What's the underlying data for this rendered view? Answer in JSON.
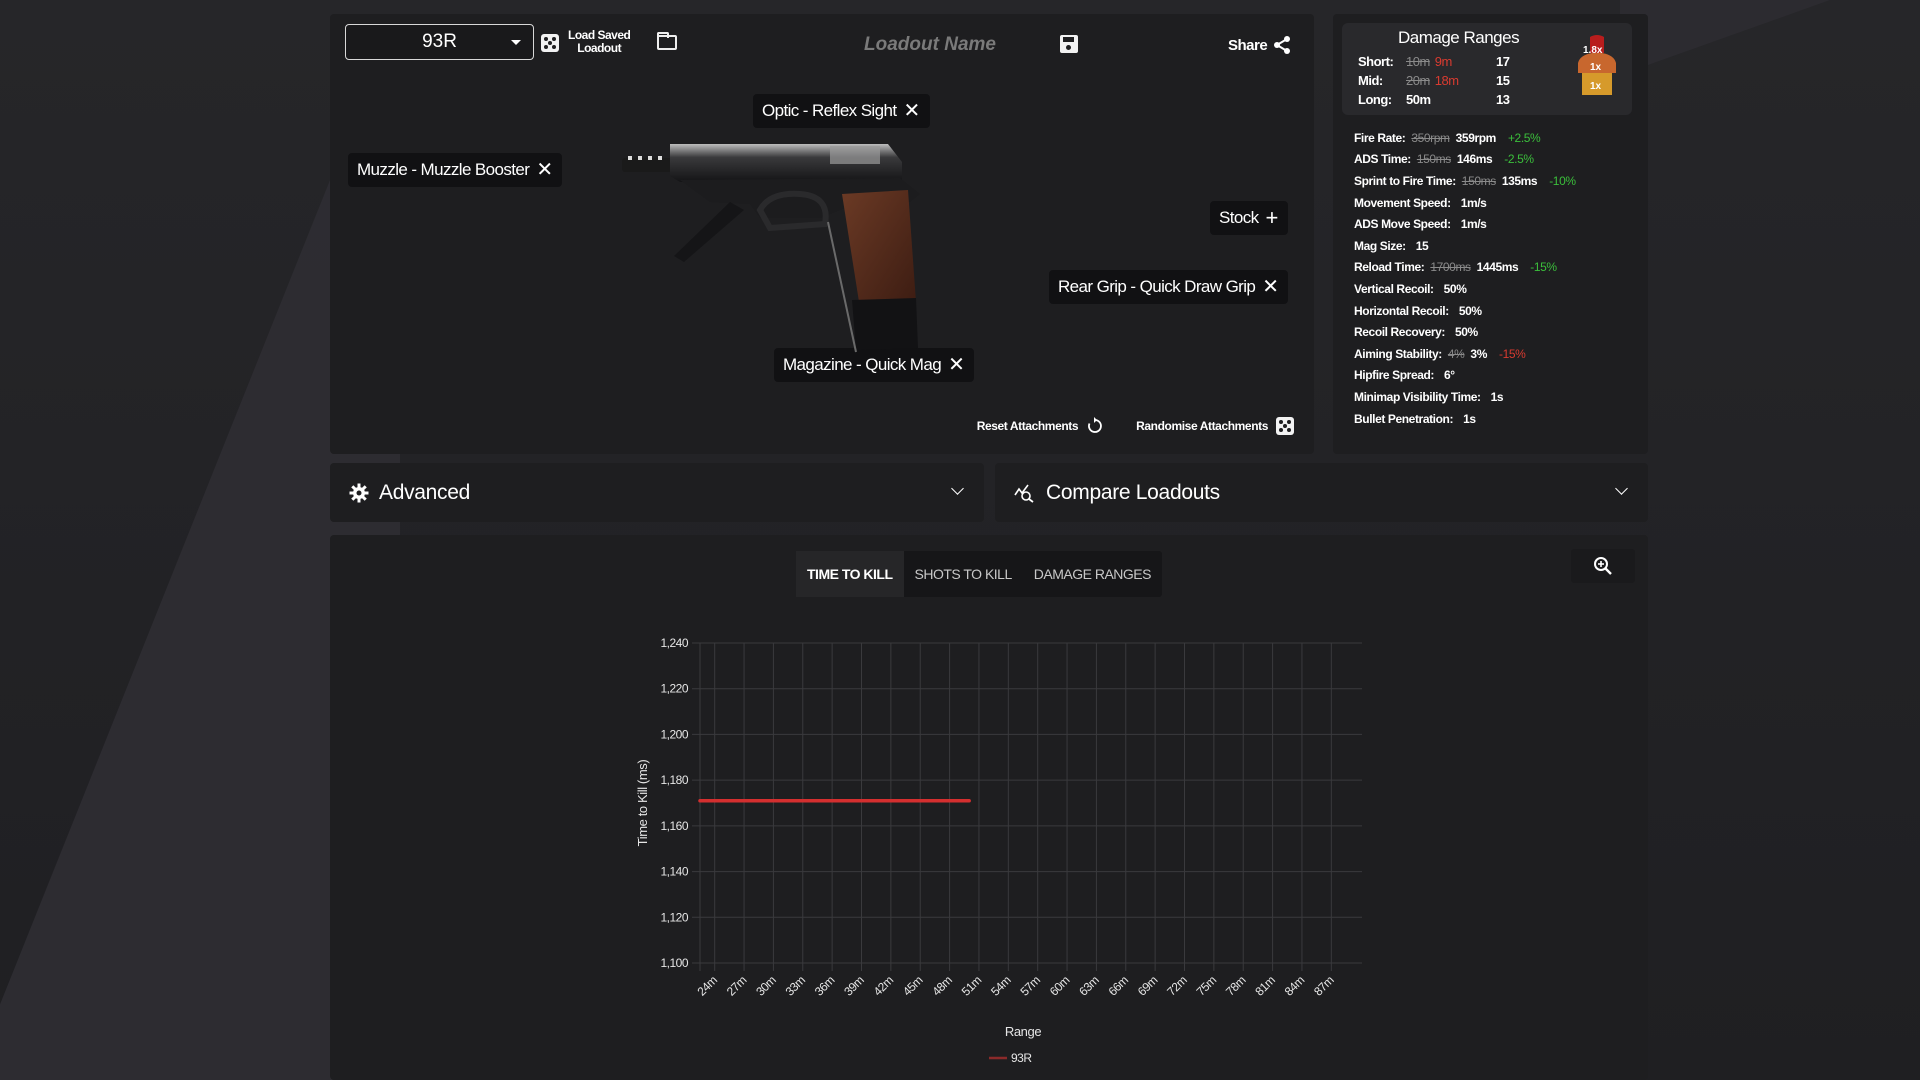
{
  "header": {
    "weapon_selected": "93R",
    "load_saved_line1": "Load Saved",
    "load_saved_line2": "Loadout",
    "loadout_name_placeholder": "Loadout Name",
    "loadout_name_value": "",
    "share_label": "Share"
  },
  "attachments": [
    {
      "slot": "Muzzle",
      "label": "Muzzle - Muzzle Booster",
      "equipped": true
    },
    {
      "slot": "Optic",
      "label": "Optic - Reflex Sight",
      "equipped": true
    },
    {
      "slot": "Stock",
      "label": "Stock",
      "equipped": false
    },
    {
      "slot": "Rear Grip",
      "label": "Rear Grip - Quick Draw Grip",
      "equipped": true
    },
    {
      "slot": "Magazine",
      "label": "Magazine - Quick Mag",
      "equipped": true
    }
  ],
  "attachment_actions": {
    "reset_label": "Reset Attachments",
    "randomise_label": "Randomise Attachments"
  },
  "damage_ranges": {
    "title": "Damage Ranges",
    "rows": [
      {
        "label": "Short:",
        "old_range": "10m",
        "new_range": "9m",
        "damage": "17"
      },
      {
        "label": "Mid:",
        "old_range": "20m",
        "new_range": "18m",
        "damage": "15"
      },
      {
        "label": "Long:",
        "old_range": "",
        "new_range": "50m",
        "damage": "13"
      }
    ],
    "multipliers": {
      "head": "1.8x",
      "chest": "1x",
      "stomach": "1x"
    }
  },
  "stats": [
    {
      "label": "Fire Rate:",
      "old": "350rpm",
      "value": "359rpm",
      "delta": "+2.5%",
      "delta_type": "good"
    },
    {
      "label": "ADS Time:",
      "old": "150ms",
      "value": "146ms",
      "delta": "-2.5%",
      "delta_type": "good"
    },
    {
      "label": "Sprint to Fire Time:",
      "old": "150ms",
      "value": "135ms",
      "delta": "-10%",
      "delta_type": "good"
    },
    {
      "label": "Movement Speed:",
      "old": "",
      "value": "1m/s",
      "delta": "",
      "delta_type": ""
    },
    {
      "label": "ADS Move Speed:",
      "old": "",
      "value": "1m/s",
      "delta": "",
      "delta_type": ""
    },
    {
      "label": "Mag Size:",
      "old": "",
      "value": "15",
      "delta": "",
      "delta_type": ""
    },
    {
      "label": "Reload Time:",
      "old": "1700ms",
      "value": "1445ms",
      "delta": "-15%",
      "delta_type": "good"
    },
    {
      "label": "Vertical Recoil:",
      "old": "",
      "value": "50%",
      "delta": "",
      "delta_type": ""
    },
    {
      "label": "Horizontal Recoil:",
      "old": "",
      "value": "50%",
      "delta": "",
      "delta_type": ""
    },
    {
      "label": "Recoil Recovery:",
      "old": "",
      "value": "50%",
      "delta": "",
      "delta_type": ""
    },
    {
      "label": "Aiming Stability:",
      "old": "4%",
      "value": "3%",
      "delta": "-15%",
      "delta_type": "bad"
    },
    {
      "label": "Hipfire Spread:",
      "old": "",
      "value": "6°",
      "delta": "",
      "delta_type": ""
    },
    {
      "label": "Minimap Visibility Time:",
      "old": "",
      "value": "1s",
      "delta": "",
      "delta_type": ""
    },
    {
      "label": "Bullet Penetration:",
      "old": "",
      "value": "1s",
      "delta": "",
      "delta_type": ""
    }
  ],
  "sections": {
    "advanced_label": "Advanced",
    "compare_label": "Compare Loadouts"
  },
  "chart_tabs": [
    {
      "label": "TIME TO KILL",
      "active": true
    },
    {
      "label": "SHOTS TO KILL",
      "active": false
    },
    {
      "label": "DAMAGE RANGES",
      "active": false
    }
  ],
  "colors": {
    "accent_red": "#d93b30",
    "good_green": "#3bbf3b",
    "series_93R": "#d42f2f"
  },
  "chart_data": {
    "type": "line",
    "title": "",
    "xlabel": "Range",
    "ylabel": "Time to Kill (ms)",
    "x_ticks": [
      "24m",
      "27m",
      "30m",
      "33m",
      "36m",
      "39m",
      "42m",
      "45m",
      "48m",
      "51m",
      "54m",
      "57m",
      "60m",
      "63m",
      "66m",
      "69m",
      "72m",
      "75m",
      "78m",
      "81m",
      "84m",
      "87m"
    ],
    "x_range_m": [
      22.5,
      88.5
    ],
    "ylim": [
      1100,
      1240
    ],
    "y_ticks": [
      1100,
      1120,
      1140,
      1160,
      1180,
      1200,
      1220,
      1240
    ],
    "y_tick_labels": [
      "1,100",
      "1,120",
      "1,140",
      "1,160",
      "1,180",
      "1,200",
      "1,220",
      "1,240"
    ],
    "grid": true,
    "legend": "bottom-center",
    "series": [
      {
        "name": "93R",
        "color": "#d42f2f",
        "x": [
          22.5,
          24,
          27,
          30,
          33,
          36,
          39,
          42,
          45,
          48,
          50
        ],
        "y": [
          1171,
          1171,
          1171,
          1171,
          1171,
          1171,
          1171,
          1171,
          1171,
          1171,
          1171
        ]
      }
    ]
  }
}
